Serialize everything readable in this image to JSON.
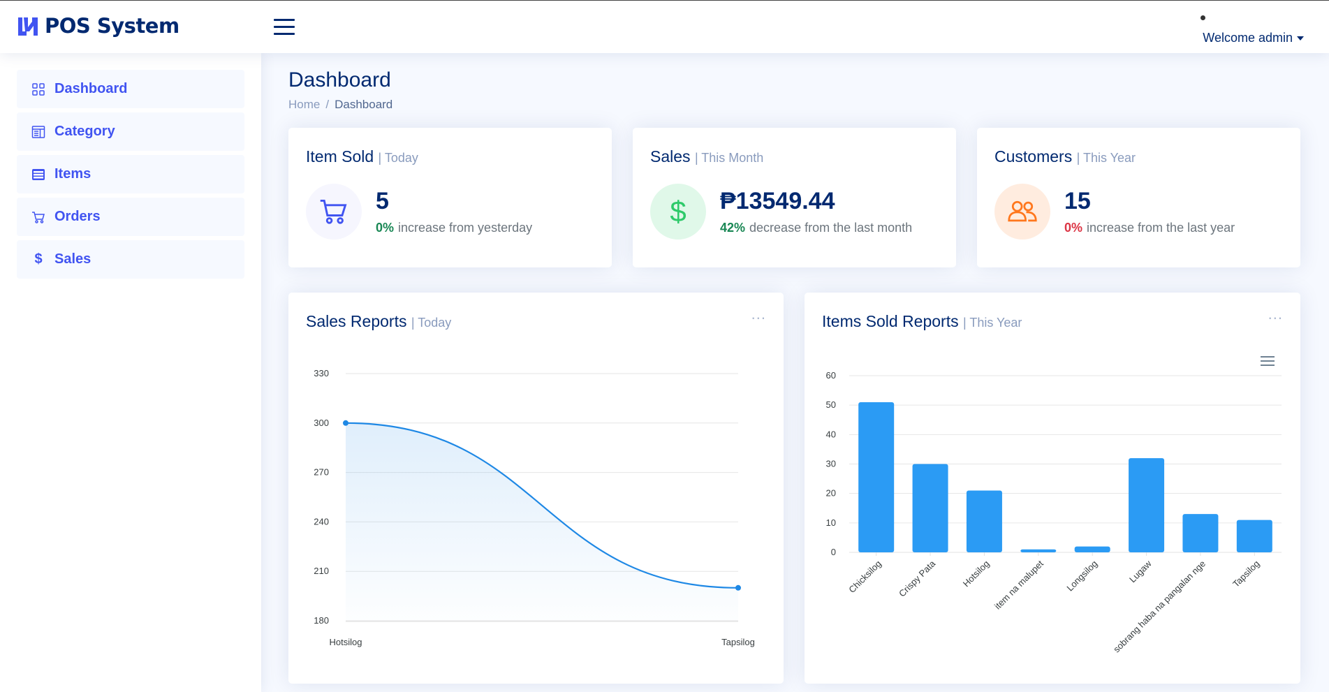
{
  "app": {
    "title": "POS System"
  },
  "header": {
    "user_label": "Welcome admin"
  },
  "sidebar": {
    "items": [
      {
        "label": "Dashboard",
        "icon": "grid-icon"
      },
      {
        "label": "Category",
        "icon": "layout-text-icon"
      },
      {
        "label": "Items",
        "icon": "card-list-icon"
      },
      {
        "label": "Orders",
        "icon": "cart-icon"
      },
      {
        "label": "Sales",
        "icon": "dollar-icon"
      }
    ]
  },
  "page": {
    "title": "Dashboard",
    "breadcrumb": [
      "Home",
      "Dashboard"
    ]
  },
  "cards": {
    "items_sold": {
      "title": "Item Sold",
      "period": "| Today",
      "value": "5",
      "pct": "0%",
      "text": "increase from yesterday",
      "pct_color": "#198754",
      "icon_bg": "#f6f6fe",
      "icon_color": "#4154f1"
    },
    "sales": {
      "title": "Sales",
      "period": "| This Month",
      "value": "₱13549.44",
      "pct": "42%",
      "text": "decrease from the last month",
      "pct_color": "#198754",
      "icon_bg": "#e0f8e9",
      "icon_color": "#2eca6a"
    },
    "customers": {
      "title": "Customers",
      "period": "| This Year",
      "value": "15",
      "pct": "0%",
      "text": "increase from the last year",
      "pct_color": "#dc3545",
      "icon_bg": "#ffecdf",
      "icon_color": "#ff771d"
    }
  },
  "reports": {
    "sales": {
      "title": "Sales Reports",
      "period": "| Today",
      "menu": "..."
    },
    "items": {
      "title": "Items Sold Reports",
      "period": "| This Year",
      "menu": "..."
    }
  },
  "chart_data": [
    {
      "type": "area",
      "title": "",
      "categories": [
        "Hotsilog",
        "Tapsilog"
      ],
      "series": [
        {
          "values": [
            300,
            200
          ]
        }
      ],
      "ylim": [
        180,
        330
      ],
      "yticks": [
        "330",
        "300",
        "270",
        "240",
        "210",
        "180"
      ],
      "grid": true,
      "color": "#1e88e5"
    },
    {
      "type": "bar",
      "title": "",
      "categories": [
        "Chicksilog",
        "Crispy Pata",
        "Hotsilog",
        "item na malupet",
        "Longsilog",
        "Lugaw",
        "sobrang haba na pangalan nge",
        "Tapsilog"
      ],
      "values": [
        51,
        30,
        21,
        1,
        2,
        32,
        13,
        11
      ],
      "ylim": [
        0,
        60
      ],
      "yticks": [
        "0",
        "10",
        "20",
        "30",
        "40",
        "50",
        "60"
      ],
      "grid": true,
      "color": "#2b9bf4"
    }
  ]
}
